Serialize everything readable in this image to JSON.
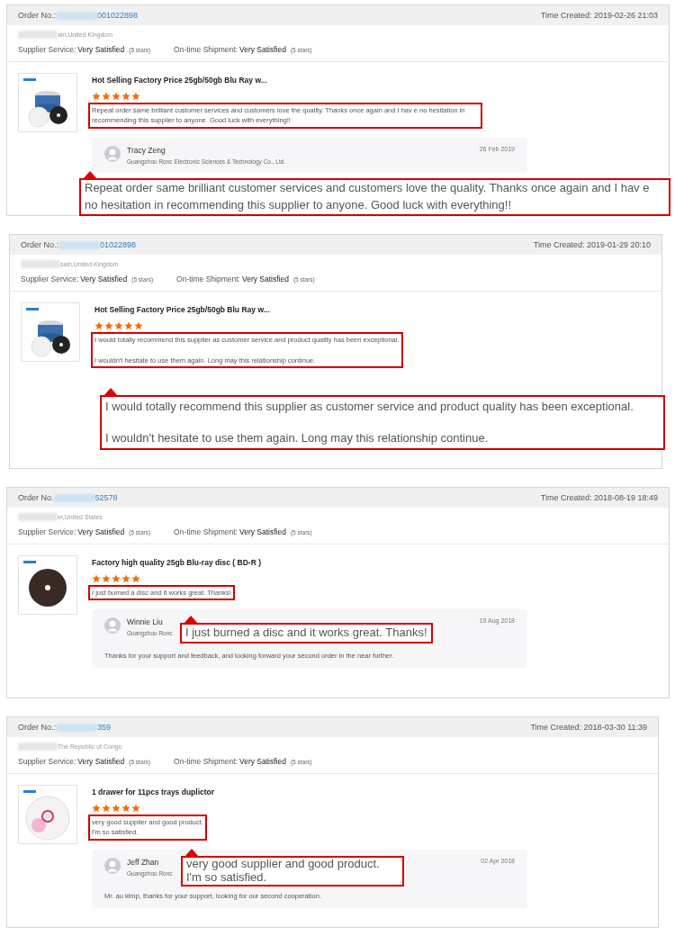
{
  "orders": [
    {
      "order_label": "Order No.:",
      "order_number": "001022898",
      "time_created": "Time Created: 2019-02-26 21:03",
      "location": "ain,United Kingdom",
      "ratings": [
        {
          "label": "Supplier Service:",
          "value": "Very Satisfied",
          "note": "(5 stars)"
        },
        {
          "label": "On-time Shipment:",
          "value": "Very Satisfied",
          "note": "(5 stars)"
        }
      ],
      "product": {
        "title": "Hot Selling Factory Price 25gb/50gb Blu Ray w...",
        "kind": "spindle"
      },
      "stars": 5,
      "review": "Repeat order same brilliant customer services and customers love the quality. Thanks once again and I hav e no hesitation in recommending this supplier to anyone. Good luck with everything!!",
      "highlighted": true,
      "reply": {
        "name": "Tracy Zeng",
        "company": "Guangzhou Ronc Electronic Sciences & Technology Co., Ltd.",
        "date": "26 Feb 2019"
      },
      "callout": "Repeat order same brilliant customer services and customers love the quality. Thanks once again and I hav e no hesitation in recommending this supplier to anyone. Good luck with everything!!"
    },
    {
      "order_label": "Order No.:",
      "order_number": "01022898",
      "time_created": "Time Created: 2019-01-29 20:10",
      "location": "sain,United Kingdom",
      "ratings": [
        {
          "label": "Supplier Service:",
          "value": "Very Satisfied",
          "note": "(5 stars)"
        },
        {
          "label": "On-time Shipment:",
          "value": "Very Satisfied",
          "note": "(5 stars)"
        }
      ],
      "product": {
        "title": "Hot Selling Factory Price 25gb/50gb Blu Ray w...",
        "kind": "spindle"
      },
      "stars": 5,
      "review": "I would totally recommend this supplier as customer service and product quality has been exceptional.\n\nI wouldn't hesitate to use them again. Long may this relationship continue.",
      "highlighted": true,
      "callout": "I would totally recommend this supplier as customer service and product quality has been exceptional.\n\nI wouldn't hesitate to use them again. Long may this relationship continue."
    },
    {
      "order_label": "Order No.",
      "order_number": "52578",
      "time_created": "Time Created: 2018-08-19 18:49",
      "location": "er,United States",
      "ratings": [
        {
          "label": "Supplier Service:",
          "value": "Very Satisfied",
          "note": "(5 stars)"
        },
        {
          "label": "On-time Shipment:",
          "value": "Very Satisfied",
          "note": "(5 stars)"
        }
      ],
      "product": {
        "title": "Factory high quality 25gb Blu-ray disc ( BD-R )",
        "kind": "black-disc"
      },
      "stars": 5,
      "review": "I just burned a disc and it works great. Thanks!",
      "highlighted": true,
      "reply": {
        "name": "Winnie Liu",
        "company": "Guangzhou Ronc",
        "date": "19 Aug 2018",
        "text": "Thanks for your support and feedback, and looking forward your second order in the near further."
      },
      "callout": "I just burned a disc and it works great. Thanks!"
    },
    {
      "order_label": "Order No.:",
      "order_number": "359",
      "time_created": "Time Created: 2018-03-30 11:39",
      "location": "The Republic of Congo",
      "ratings": [
        {
          "label": "Supplier Service:",
          "value": "Very Satisfied",
          "note": "(5 stars)"
        },
        {
          "label": "On-time Shipment:",
          "value": "Very Satisfied",
          "note": "(5 stars)"
        }
      ],
      "product": {
        "title": "1 drawer for 11pcs trays duplictor",
        "kind": "printed-disc"
      },
      "stars": 5,
      "review": "very good supplier and good product.\nI'm so satisfied.",
      "highlighted": true,
      "reply": {
        "name": "Jeff Zhan",
        "company": "Guangzhou Ronc",
        "date": "02 Apr 2018",
        "text": "Mr. au kimp, thanks for your support, looking for our second cooperation."
      },
      "callout": "very good supplier and good product.\nI'm so satisfied."
    }
  ]
}
